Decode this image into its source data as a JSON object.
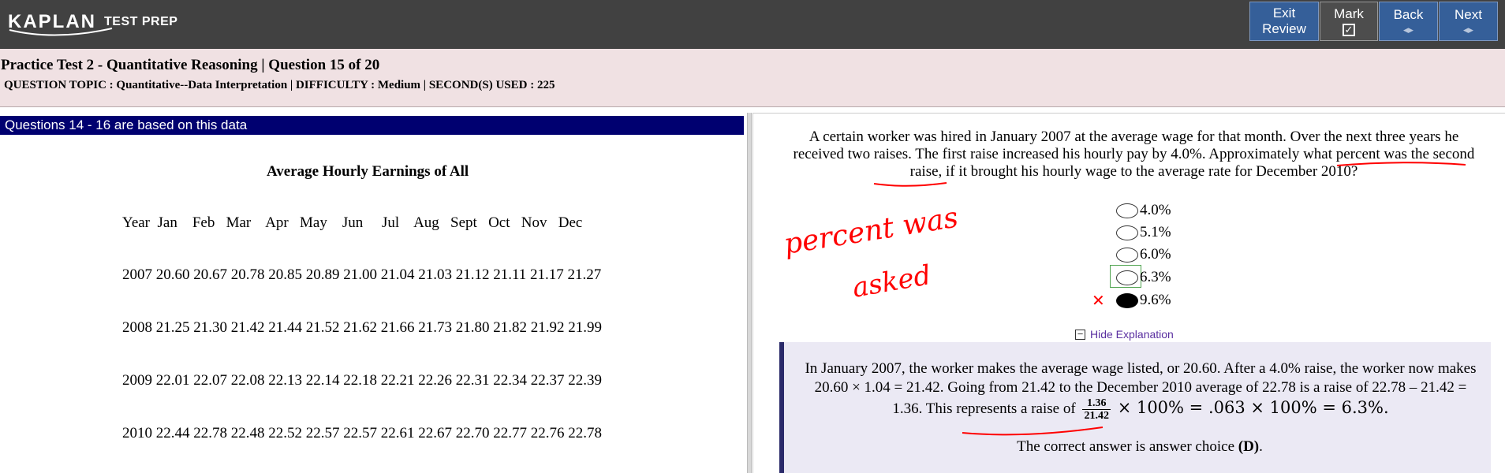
{
  "brand": {
    "logo_text": "KAPLAN",
    "logo_sub": "TEST PREP"
  },
  "nav": {
    "exit_line1": "Exit",
    "exit_line2": "Review",
    "mark_label": "Mark",
    "mark_glyph": "✓",
    "back_label": "Back",
    "next_label": "Next",
    "arrow_glyph": "◂▸"
  },
  "header": {
    "title": "Practice Test 2 - Quantitative Reasoning | Question  15 of 20",
    "topic_line": "QUESTION TOPIC : Quantitative--Data Interpretation | DIFFICULTY : Medium | SECOND(S) USED : 225"
  },
  "data_panel": {
    "bar_label": "Questions 14 - 16 are based on this data",
    "table_title": "Average Hourly Earnings of All",
    "header_row": "Year  Jan    Feb   Mar    Apr   May    Jun     Jul    Aug   Sept   Oct   Nov   Dec",
    "rows": [
      "2007 20.60 20.67 20.78 20.85 20.89 21.00 21.04 21.03 21.12 21.11 21.17 21.27",
      "2008 21.25 21.30 21.42 21.44 21.52 21.62 21.66 21.73 21.80 21.82 21.92 21.99",
      "2009 22.01 22.07 22.08 22.13 22.14 22.18 22.21 22.26 22.31 22.34 22.37 22.39",
      "2010 22.44 22.78 22.48 22.52 22.57 22.57 22.61 22.67 22.70 22.77 22.76 22.78"
    ]
  },
  "question": {
    "text": "A certain worker was hired in January 2007 at the average wage for that month. Over the next three years he received two raises. The first raise increased his hourly pay by 4.0%. Approximately what percent was the second raise, if it brought his hourly wage to the average rate for December 2010?",
    "choices": [
      {
        "label": "4.0%"
      },
      {
        "label": "5.1%"
      },
      {
        "label": "6.0%"
      },
      {
        "label": "6.3%"
      },
      {
        "label": "9.6%"
      }
    ],
    "wrong_mark": "✕"
  },
  "explanation": {
    "toggle_label": "Hide Explanation",
    "toggle_glyph": "−",
    "part1": "In January 2007, the worker makes the average wage listed, or 20.60. After a 4.0% raise, the worker now makes 20.60 × 1.04 = 21.42. Going from 21.42 to the December 2010 average of 22.78 is a raise of 22.78 – 21.42 = 1.36. This represents a raise of",
    "frac_num": "1.36",
    "frac_den": "21.42",
    "math": "× 100% = .063 × 100% = 6.3%.",
    "correct_text": "The correct answer is answer choice",
    "correct_choice": "(D)",
    "correct_end": "."
  },
  "handwriting": {
    "line1": "percent was",
    "line2": "asked"
  },
  "colors": {
    "topbar": "#414141",
    "nav_button": "#355f99",
    "header_band": "#f0e1e3",
    "data_bar": "#000070",
    "annotation_red": "#ff0000",
    "explanation_bg": "#ebe9f4"
  }
}
